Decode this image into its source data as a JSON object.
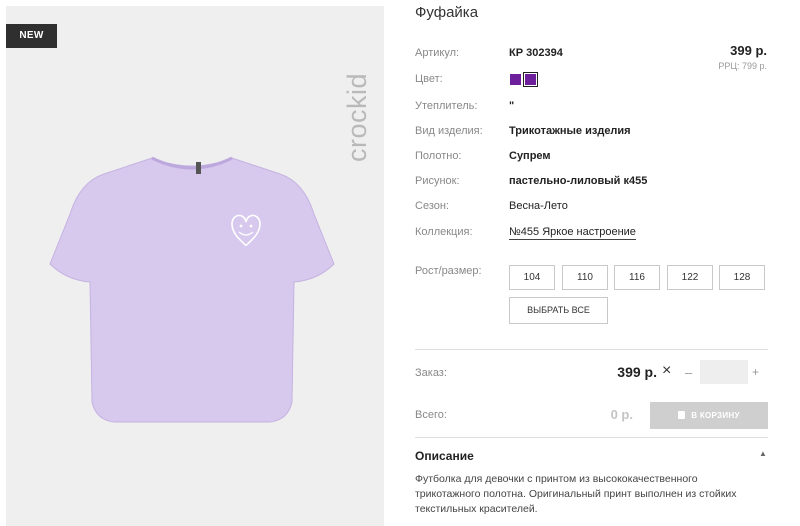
{
  "badge": {
    "new": "NEW"
  },
  "brand": {
    "logo_text": "crockid"
  },
  "product": {
    "title": "Фуфайка",
    "price": "399 р.",
    "rrp": "РРЦ: 799 р."
  },
  "attributes": [
    {
      "label": "Артикул:",
      "value": "КР 302394"
    },
    {
      "label": "Цвет:",
      "value": ""
    },
    {
      "label": "Утеплитель:",
      "value": "\""
    },
    {
      "label": "Вид изделия:",
      "value": "Трикотажные изделия"
    },
    {
      "label": "Полотно:",
      "value": "Супрем"
    },
    {
      "label": "Рисунок:",
      "value": "пастельно-лиловый к455"
    },
    {
      "label": "Сезон:",
      "value": "Весна-Лето"
    },
    {
      "label": "Коллекция:",
      "value": "№455 Яркое настроение"
    }
  ],
  "colors": {
    "swatch": "#6d1f9c",
    "tshirt": "#d7c8ee",
    "badge_bg": "#2f2f2f"
  },
  "sizes": {
    "label": "Рост/размер:",
    "options": [
      "104",
      "110",
      "116",
      "122",
      "128"
    ],
    "select_all": "ВЫБРАТЬ ВСЕ"
  },
  "order": {
    "label": "Заказ:",
    "price": "399 р.",
    "times": "×",
    "minus": "–",
    "plus": "+",
    "quantity": ""
  },
  "total": {
    "label": "Всего:",
    "value": "0 р.",
    "cart_button": "В КОРЗИНУ"
  },
  "description": {
    "title": "Описание",
    "text": "Футболка для девочки с принтом из высококачественного трикотажного полотна. Оригинальный принт выполнен из стойких текстильных красителей."
  }
}
